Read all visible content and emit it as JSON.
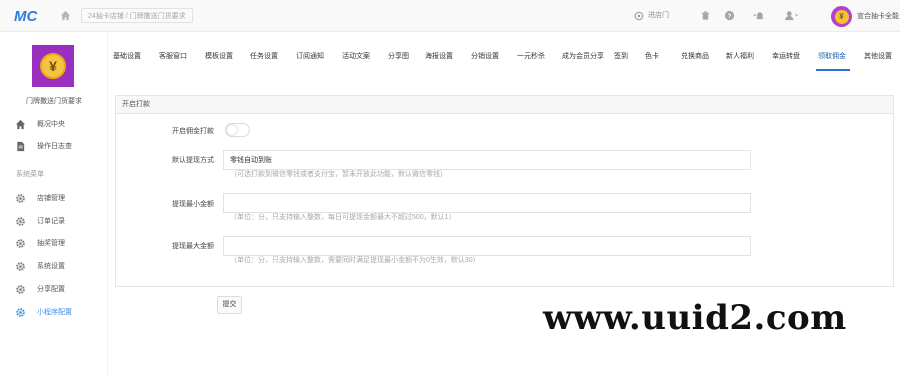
{
  "header": {
    "logo_text": "MC",
    "breadcrumb": "24抽卡店铺 / 门牌撒送门货要求",
    "store_link": "进店门",
    "user_name": "宣合抽卡全能",
    "icons": [
      "home-icon",
      "store-icon",
      "trash-icon",
      "help-icon",
      "bell-icon",
      "user-icon"
    ]
  },
  "sidebar": {
    "shop_name": "门牌撒送门货要求",
    "items_top": [
      {
        "label": "概况中央",
        "icon": "home-icon"
      },
      {
        "label": "操作日志查",
        "icon": "document-icon"
      }
    ],
    "section_title": "系统菜单",
    "items": [
      {
        "label": "店铺管理",
        "icon": "gear-icon"
      },
      {
        "label": "订单记录",
        "icon": "gear-icon"
      },
      {
        "label": "抽奖管理",
        "icon": "gear-icon"
      },
      {
        "label": "系统设置",
        "icon": "gear-icon"
      },
      {
        "label": "分享配置",
        "icon": "gear-icon"
      },
      {
        "label": "小程序配置",
        "icon": "gear-icon",
        "active": true
      }
    ]
  },
  "tabs": [
    {
      "label": "基础设置"
    },
    {
      "label": "客服窗口"
    },
    {
      "label": "模板设置"
    },
    {
      "label": "任务设置"
    },
    {
      "label": "订阅通知"
    },
    {
      "label": "活动文案"
    },
    {
      "label": "分享图"
    },
    {
      "label": "海报设置"
    },
    {
      "label": "分销设置"
    },
    {
      "label": "一元秒杀"
    },
    {
      "label": "成为会员分享"
    },
    {
      "label": "签到"
    },
    {
      "label": "色卡"
    },
    {
      "label": "兑换商品"
    },
    {
      "label": "新人福利"
    },
    {
      "label": "幸运转盘"
    },
    {
      "label": "领取佣金",
      "active": true
    },
    {
      "label": "其他设置"
    }
  ],
  "panel": {
    "title": "开启打款",
    "toggle_label": "开启佣金打款",
    "toggle_on": false,
    "fields": [
      {
        "label": "默认提现方式",
        "value": "零钱自动到账",
        "placeholder": "",
        "hint": "（可选打款到微信零钱或者支付宝，暂未开放此功能，默认微信零钱）"
      },
      {
        "label": "提现最小金额",
        "value": "",
        "placeholder": "",
        "hint": "（单位：分，只支持输入整数，每日可提现金额最大不超过500，默认1）"
      },
      {
        "label": "提现最大金额",
        "value": "",
        "placeholder": "",
        "hint": "（单位：分，只支持输入整数，需要同时满足提现最小金额不为0生效，默认30）"
      }
    ],
    "submit_label": "提交"
  },
  "watermark": "www.uuid2.com"
}
